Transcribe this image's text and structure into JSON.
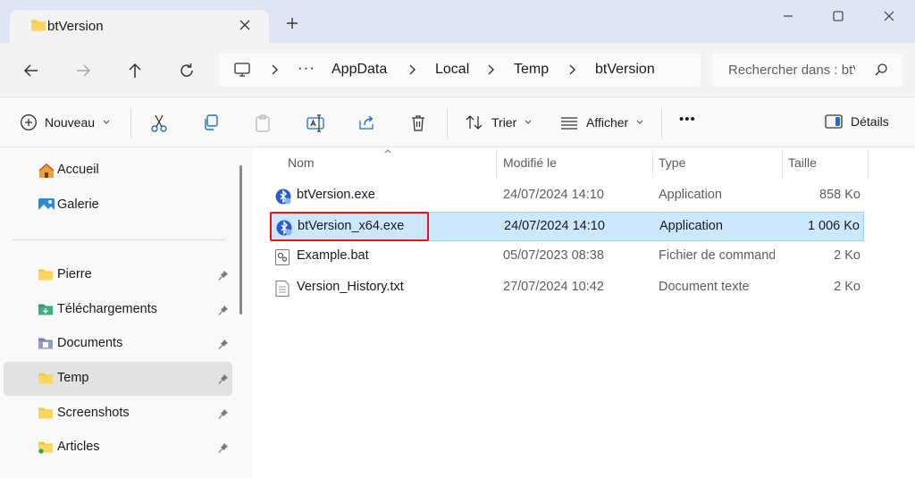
{
  "window": {
    "tab_title": "btVersion",
    "new_tab_icon": "plus-icon",
    "controls": [
      "minimize-icon",
      "maximize-icon",
      "close-icon"
    ]
  },
  "nav": {
    "buttons": [
      "back-arrow-icon",
      "forward-arrow-icon",
      "up-arrow-icon",
      "refresh-icon"
    ],
    "breadcrumb": [
      "AppData",
      "Local",
      "Temp",
      "btVersion"
    ],
    "breadcrumb_overflow": "···",
    "search_placeholder": "Rechercher dans : btVersion"
  },
  "toolbar": {
    "new_label": "Nouveau",
    "sort_label": "Trier",
    "view_label": "Afficher",
    "more_label": "•••",
    "details_label": "Détails",
    "icons": [
      "cut-icon",
      "copy-icon",
      "paste-icon",
      "rename-icon",
      "share-icon",
      "delete-icon"
    ]
  },
  "sidebar": {
    "top_items": [
      {
        "label": "Accueil",
        "icon": "home-icon"
      },
      {
        "label": "Galerie",
        "icon": "gallery-icon"
      }
    ],
    "pinned_items": [
      {
        "label": "Pierre",
        "icon": "folder-icon",
        "pinned": true
      },
      {
        "label": "Téléchargements",
        "icon": "downloads-folder-icon",
        "pinned": true
      },
      {
        "label": "Documents",
        "icon": "documents-folder-icon",
        "pinned": true
      },
      {
        "label": "Temp",
        "icon": "folder-icon",
        "pinned": true,
        "selected": true
      },
      {
        "label": "Screenshots",
        "icon": "folder-icon",
        "pinned": true
      },
      {
        "label": "Articles",
        "icon": "folder-icon",
        "pinned": true
      }
    ]
  },
  "files": {
    "columns": [
      "Nom",
      "Modifié le",
      "Type",
      "Taille"
    ],
    "sorted_by": "Nom",
    "rows": [
      {
        "name": "btVersion.exe",
        "modified": "24/07/2024 14:10",
        "type": "Application",
        "size": "858 Ko",
        "icon": "bluetooth-app-icon",
        "selected": false
      },
      {
        "name": "btVersion_x64.exe",
        "modified": "24/07/2024 14:10",
        "type": "Application",
        "size": "1 006 Ko",
        "icon": "bluetooth-app-icon",
        "selected": true
      },
      {
        "name": "Example.bat",
        "modified": "05/07/2023 08:38",
        "type": "Fichier de commandes Windows",
        "size": "2 Ko",
        "icon": "batch-file-icon",
        "selected": false
      },
      {
        "name": "Version_History.txt",
        "modified": "27/07/2024 10:42",
        "type": "Document texte",
        "size": "2 Ko",
        "icon": "text-file-icon",
        "selected": false
      }
    ]
  },
  "colors": {
    "selection_bg": "#cce8ff",
    "highlight_border": "#e8141c",
    "folder_yellow": "#f8c838"
  }
}
